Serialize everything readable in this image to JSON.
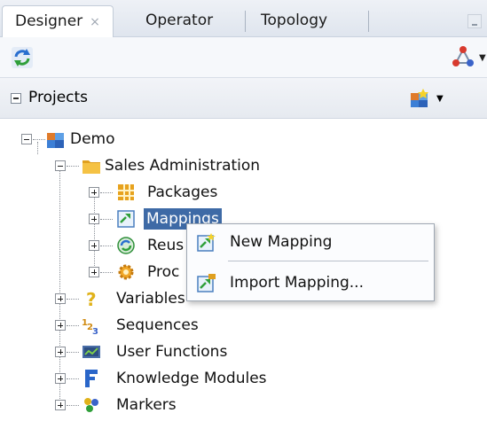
{
  "tabs": [
    {
      "label": "Designer",
      "close": "×",
      "active": true
    },
    {
      "label": "Operator",
      "active": false
    },
    {
      "label": "Topology",
      "active": false
    }
  ],
  "section": {
    "title": "Projects"
  },
  "tree": {
    "demo": "Demo",
    "sales_admin": "Sales Administration",
    "packages": "Packages",
    "mappings": "Mappings",
    "reusable_truncated": "Reus",
    "procedures_truncated": "Proc",
    "variables": "Variables",
    "sequences": "Sequences",
    "user_functions": "User Functions",
    "knowledge_modules": "Knowledge Modules",
    "markers": "Markers"
  },
  "context_menu": {
    "new_mapping": "New Mapping",
    "import_mapping": "Import Mapping..."
  },
  "colors": {
    "selection": "#3e6aa6",
    "folder": "#f2b636",
    "tab_bar": "#dfe5ee"
  },
  "icons": {
    "refresh": "refresh-icon",
    "connect": "connect-icon",
    "new_project": "new-project-icon",
    "dropdown": "▼"
  }
}
